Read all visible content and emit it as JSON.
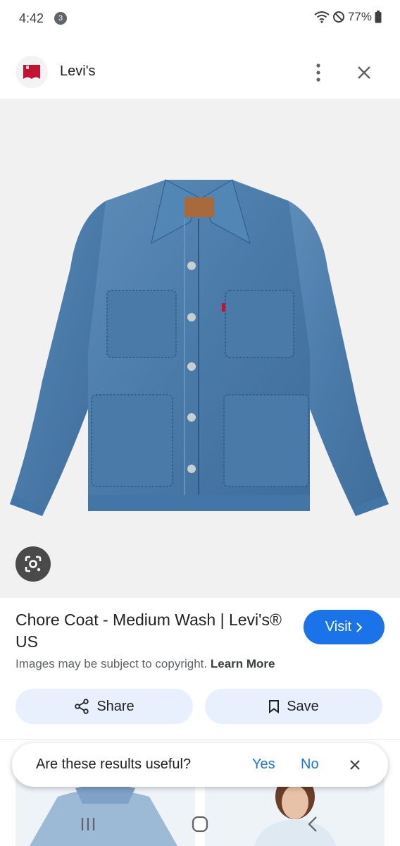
{
  "status_bar": {
    "time": "4:42",
    "notification_count": "3",
    "battery": "77%",
    "icons": [
      "wifi-icon",
      "dnd-icon",
      "battery-icon"
    ]
  },
  "header": {
    "site_name": "Levi's",
    "logo_icon": "levis-logo-icon",
    "more_icon": "more-vert-icon",
    "close_icon": "close-icon"
  },
  "image": {
    "subject": "denim-jacket",
    "lens_icon": "lens-icon"
  },
  "result": {
    "title": "Chore Coat - Medium Wash | Levi's® US",
    "visit_label": "Visit",
    "copyright_text": "Images may be subject to copyright.",
    "learn_more": "Learn More"
  },
  "actions": {
    "share_label": "Share",
    "save_label": "Save"
  },
  "feedback": {
    "question": "Are these results useful?",
    "yes": "Yes",
    "no": "No"
  },
  "colors": {
    "accent": "#1a73e8",
    "action_bg": "#e8f0fe",
    "levis_red": "#c41230",
    "denim": "#4f7fab"
  }
}
